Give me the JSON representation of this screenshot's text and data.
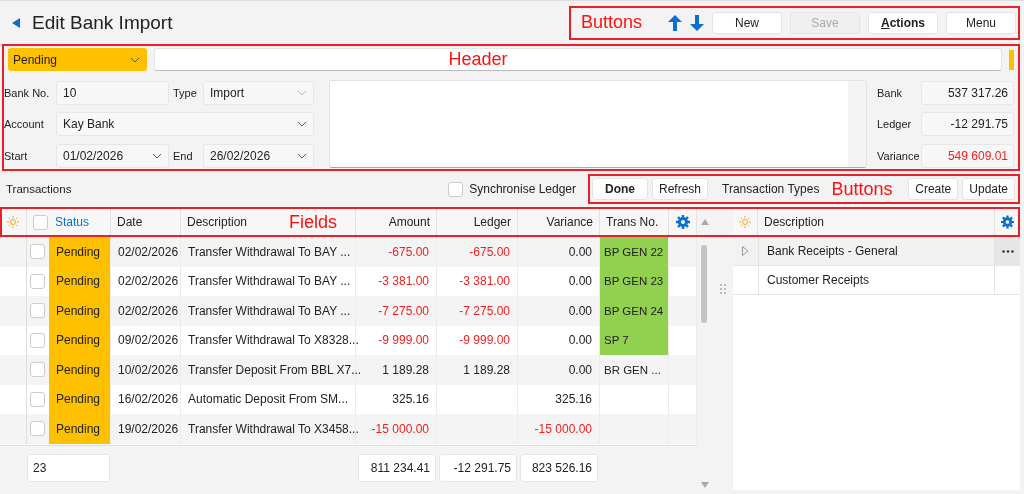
{
  "title": "Edit Bank Import",
  "toolbar": {
    "annotation": "Buttons",
    "buttons": [
      {
        "label": "New",
        "disabled": false,
        "mnemonic": false
      },
      {
        "label": "Save",
        "disabled": true,
        "mnemonic": false
      },
      {
        "label": "Actions",
        "disabled": false,
        "mnemonic": true
      },
      {
        "label": "Menu",
        "disabled": false,
        "mnemonic": false
      }
    ]
  },
  "header": {
    "annotation": "Header",
    "status": {
      "value": "Pending",
      "color": "#ffc000"
    },
    "bank_no": {
      "label": "Bank No.",
      "value": "10"
    },
    "type": {
      "label": "Type",
      "value": "Import"
    },
    "account": {
      "label": "Account",
      "value": "Kay Bank"
    },
    "start": {
      "label": "Start",
      "value": "01/02/2026"
    },
    "end": {
      "label": "End",
      "value": "26/02/2026"
    },
    "totals": [
      {
        "label": "Bank",
        "value": "537 317.26",
        "negative": false
      },
      {
        "label": "Ledger",
        "value": "-12 291.75",
        "negative": false
      },
      {
        "label": "Variance",
        "value": "549 609.01",
        "negative": true
      }
    ]
  },
  "transactions": {
    "title": "Transactions",
    "synchronise": {
      "label": "Synchronise Ledger",
      "checked": false
    },
    "annotation": "Buttons",
    "buttons": [
      {
        "label": "Done",
        "bold": true
      },
      {
        "label": "Refresh",
        "bold": false
      }
    ],
    "types_label": "Transaction Types",
    "type_buttons": [
      "Create",
      "Update"
    ]
  },
  "fields_annotation": "Fields",
  "table": {
    "select_all": false,
    "columns": [
      "Status",
      "Date",
      "Description",
      "Amount",
      "Ledger",
      "Variance",
      "Trans No."
    ],
    "rows": [
      {
        "checked": false,
        "status": "Pending",
        "color": "#ffc000",
        "date": "02/02/2026",
        "description": "Transfer Withdrawal To BAY ...",
        "amount": "-675.00",
        "ledger": "-675.00",
        "variance": "0.00",
        "amount_negative": true,
        "variance_negative": false,
        "trans_no": "BP GEN 22",
        "matched": true
      },
      {
        "checked": false,
        "status": "Pending",
        "color": "#ffc000",
        "date": "02/02/2026",
        "description": "Transfer Withdrawal To BAY ...",
        "amount": "-3 381.00",
        "ledger": "-3 381.00",
        "variance": "0.00",
        "amount_negative": true,
        "variance_negative": false,
        "trans_no": "BP GEN 23",
        "matched": true
      },
      {
        "checked": false,
        "status": "Pending",
        "color": "#ffc000",
        "date": "02/02/2026",
        "description": "Transfer Withdrawal To BAY ...",
        "amount": "-7 275.00",
        "ledger": "-7 275.00",
        "variance": "0.00",
        "amount_negative": true,
        "variance_negative": false,
        "trans_no": "BP GEN 24",
        "matched": true
      },
      {
        "checked": false,
        "status": "Pending",
        "color": "#ffc000",
        "date": "09/02/2026",
        "description": "Transfer Withdrawal To X8328...",
        "amount": "-9 999.00",
        "ledger": "-9 999.00",
        "variance": "0.00",
        "amount_negative": true,
        "variance_negative": false,
        "trans_no": "SP 7",
        "matched": true
      },
      {
        "checked": false,
        "status": "Pending",
        "color": "#ffc000",
        "date": "10/02/2026",
        "description": "Transfer Deposit From BBL X7...",
        "amount": "1 189.28",
        "ledger": "1 189.28",
        "variance": "0.00",
        "amount_negative": false,
        "variance_negative": false,
        "trans_no": "BR GEN ...",
        "matched": false
      },
      {
        "checked": false,
        "status": "Pending",
        "color": "#ffc000",
        "date": "16/02/2026",
        "description": "Automatic Deposit From SM...",
        "amount": "325.16",
        "variance": "325.16",
        "amount_negative": false,
        "variance_negative": false,
        "matched": false
      },
      {
        "checked": false,
        "status": "Pending",
        "color": "#ffc000",
        "date": "19/02/2026",
        "description": "Transfer Withdrawal To X3458...",
        "amount": "-15 000.00",
        "variance": "-15 000.00",
        "amount_negative": true,
        "variance_negative": true,
        "matched": false
      }
    ],
    "footer": {
      "count": "23",
      "amount": "811 234.41",
      "ledger": "-12 291.75",
      "variance": "823 526.16"
    }
  },
  "types": {
    "column": "Description",
    "items": [
      {
        "label": "Bank Receipts - General",
        "expandable": true,
        "selected": true
      },
      {
        "label": "Customer Receipts",
        "expandable": false,
        "selected": false
      }
    ]
  }
}
